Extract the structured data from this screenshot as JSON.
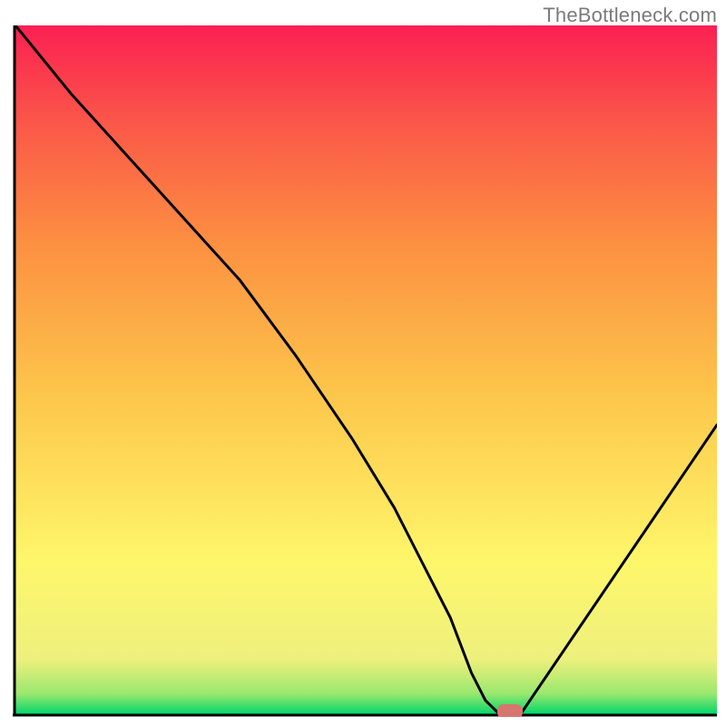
{
  "watermark": "TheBottleneck.com",
  "chart_data": {
    "type": "line",
    "title": "",
    "xlabel": "",
    "ylabel": "",
    "xlim": [
      0,
      100
    ],
    "ylim": [
      0,
      100
    ],
    "grid": false,
    "legend": false,
    "background_gradient": [
      {
        "pos": 0.0,
        "color": "#00d66b"
      },
      {
        "pos": 0.03,
        "color": "#9be86e"
      },
      {
        "pos": 0.08,
        "color": "#eef07d"
      },
      {
        "pos": 0.22,
        "color": "#fef76b"
      },
      {
        "pos": 0.45,
        "color": "#fdc94c"
      },
      {
        "pos": 0.68,
        "color": "#fc9141"
      },
      {
        "pos": 0.85,
        "color": "#fb5a48"
      },
      {
        "pos": 1.0,
        "color": "#fb2052"
      }
    ],
    "series": [
      {
        "name": "bottleneck-curve",
        "x": [
          0,
          8,
          16,
          24,
          32,
          40,
          48,
          54,
          58,
          62,
          65,
          67,
          69,
          72,
          76,
          82,
          90,
          100
        ],
        "y": [
          100,
          90,
          81,
          72,
          63,
          52,
          40,
          30,
          22,
          14,
          6,
          2,
          0,
          0,
          6,
          15,
          27,
          42
        ]
      }
    ],
    "marker": {
      "name": "optimal-point",
      "x": 70.5,
      "y": 0,
      "color": "#d6766f",
      "shape": "rounded-rect"
    }
  }
}
